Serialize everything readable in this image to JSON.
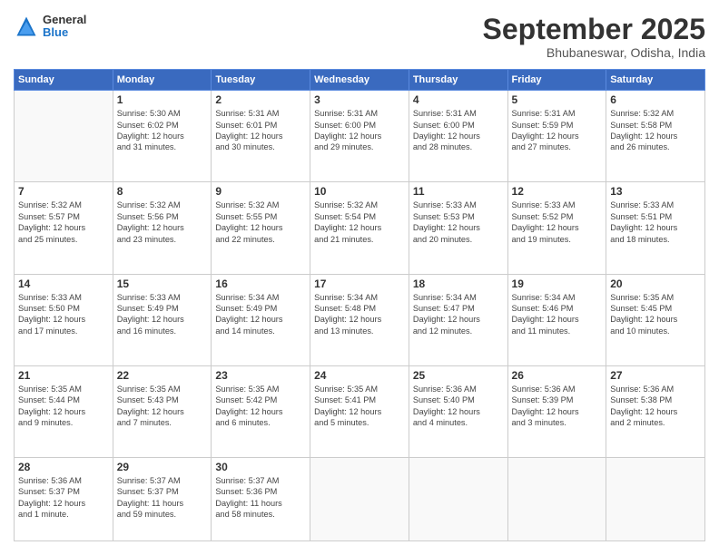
{
  "logo": {
    "general": "General",
    "blue": "Blue"
  },
  "header": {
    "title": "September 2025",
    "location": "Bhubaneswar, Odisha, India"
  },
  "weekdays": [
    "Sunday",
    "Monday",
    "Tuesday",
    "Wednesday",
    "Thursday",
    "Friday",
    "Saturday"
  ],
  "weeks": [
    [
      {
        "day": "",
        "info": ""
      },
      {
        "day": "1",
        "info": "Sunrise: 5:30 AM\nSunset: 6:02 PM\nDaylight: 12 hours\nand 31 minutes."
      },
      {
        "day": "2",
        "info": "Sunrise: 5:31 AM\nSunset: 6:01 PM\nDaylight: 12 hours\nand 30 minutes."
      },
      {
        "day": "3",
        "info": "Sunrise: 5:31 AM\nSunset: 6:00 PM\nDaylight: 12 hours\nand 29 minutes."
      },
      {
        "day": "4",
        "info": "Sunrise: 5:31 AM\nSunset: 6:00 PM\nDaylight: 12 hours\nand 28 minutes."
      },
      {
        "day": "5",
        "info": "Sunrise: 5:31 AM\nSunset: 5:59 PM\nDaylight: 12 hours\nand 27 minutes."
      },
      {
        "day": "6",
        "info": "Sunrise: 5:32 AM\nSunset: 5:58 PM\nDaylight: 12 hours\nand 26 minutes."
      }
    ],
    [
      {
        "day": "7",
        "info": "Sunrise: 5:32 AM\nSunset: 5:57 PM\nDaylight: 12 hours\nand 25 minutes."
      },
      {
        "day": "8",
        "info": "Sunrise: 5:32 AM\nSunset: 5:56 PM\nDaylight: 12 hours\nand 23 minutes."
      },
      {
        "day": "9",
        "info": "Sunrise: 5:32 AM\nSunset: 5:55 PM\nDaylight: 12 hours\nand 22 minutes."
      },
      {
        "day": "10",
        "info": "Sunrise: 5:32 AM\nSunset: 5:54 PM\nDaylight: 12 hours\nand 21 minutes."
      },
      {
        "day": "11",
        "info": "Sunrise: 5:33 AM\nSunset: 5:53 PM\nDaylight: 12 hours\nand 20 minutes."
      },
      {
        "day": "12",
        "info": "Sunrise: 5:33 AM\nSunset: 5:52 PM\nDaylight: 12 hours\nand 19 minutes."
      },
      {
        "day": "13",
        "info": "Sunrise: 5:33 AM\nSunset: 5:51 PM\nDaylight: 12 hours\nand 18 minutes."
      }
    ],
    [
      {
        "day": "14",
        "info": "Sunrise: 5:33 AM\nSunset: 5:50 PM\nDaylight: 12 hours\nand 17 minutes."
      },
      {
        "day": "15",
        "info": "Sunrise: 5:33 AM\nSunset: 5:49 PM\nDaylight: 12 hours\nand 16 minutes."
      },
      {
        "day": "16",
        "info": "Sunrise: 5:34 AM\nSunset: 5:49 PM\nDaylight: 12 hours\nand 14 minutes."
      },
      {
        "day": "17",
        "info": "Sunrise: 5:34 AM\nSunset: 5:48 PM\nDaylight: 12 hours\nand 13 minutes."
      },
      {
        "day": "18",
        "info": "Sunrise: 5:34 AM\nSunset: 5:47 PM\nDaylight: 12 hours\nand 12 minutes."
      },
      {
        "day": "19",
        "info": "Sunrise: 5:34 AM\nSunset: 5:46 PM\nDaylight: 12 hours\nand 11 minutes."
      },
      {
        "day": "20",
        "info": "Sunrise: 5:35 AM\nSunset: 5:45 PM\nDaylight: 12 hours\nand 10 minutes."
      }
    ],
    [
      {
        "day": "21",
        "info": "Sunrise: 5:35 AM\nSunset: 5:44 PM\nDaylight: 12 hours\nand 9 minutes."
      },
      {
        "day": "22",
        "info": "Sunrise: 5:35 AM\nSunset: 5:43 PM\nDaylight: 12 hours\nand 7 minutes."
      },
      {
        "day": "23",
        "info": "Sunrise: 5:35 AM\nSunset: 5:42 PM\nDaylight: 12 hours\nand 6 minutes."
      },
      {
        "day": "24",
        "info": "Sunrise: 5:35 AM\nSunset: 5:41 PM\nDaylight: 12 hours\nand 5 minutes."
      },
      {
        "day": "25",
        "info": "Sunrise: 5:36 AM\nSunset: 5:40 PM\nDaylight: 12 hours\nand 4 minutes."
      },
      {
        "day": "26",
        "info": "Sunrise: 5:36 AM\nSunset: 5:39 PM\nDaylight: 12 hours\nand 3 minutes."
      },
      {
        "day": "27",
        "info": "Sunrise: 5:36 AM\nSunset: 5:38 PM\nDaylight: 12 hours\nand 2 minutes."
      }
    ],
    [
      {
        "day": "28",
        "info": "Sunrise: 5:36 AM\nSunset: 5:37 PM\nDaylight: 12 hours\nand 1 minute."
      },
      {
        "day": "29",
        "info": "Sunrise: 5:37 AM\nSunset: 5:37 PM\nDaylight: 11 hours\nand 59 minutes."
      },
      {
        "day": "30",
        "info": "Sunrise: 5:37 AM\nSunset: 5:36 PM\nDaylight: 11 hours\nand 58 minutes."
      },
      {
        "day": "",
        "info": ""
      },
      {
        "day": "",
        "info": ""
      },
      {
        "day": "",
        "info": ""
      },
      {
        "day": "",
        "info": ""
      }
    ]
  ]
}
